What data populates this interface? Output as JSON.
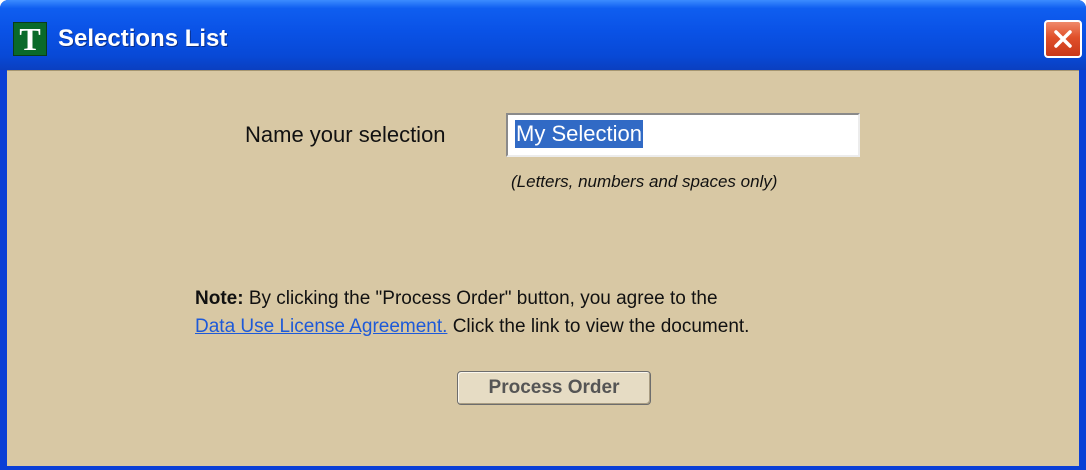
{
  "window": {
    "title": "Selections List",
    "app_icon_letter": "T",
    "close_icon": "close-icon"
  },
  "form": {
    "name_label": "Name your selection",
    "name_value": "My Selection",
    "hint": "(Letters, numbers and spaces only)"
  },
  "note": {
    "bold_prefix": "Note:",
    "text_line1": " By clicking the \"Process Order\" button, you agree to the",
    "link_text": "Data Use License Agreement.",
    "text_line2": " Click the link to view the document."
  },
  "actions": {
    "process_label": "Process Order"
  },
  "colors": {
    "titlebar": "#0a52e6",
    "client_bg": "#d8c8a4",
    "link": "#1e5ad8",
    "selection_highlight": "#316ac5",
    "close_button": "#e0502a"
  }
}
